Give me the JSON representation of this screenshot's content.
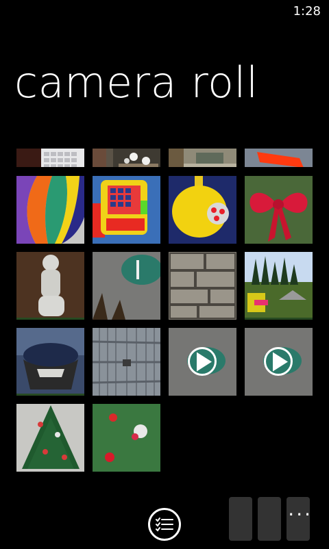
{
  "status": {
    "time": "1:28"
  },
  "page": {
    "title": "camera roll"
  },
  "appbar": {
    "select_icon": "checklist-icon",
    "more_label": "..."
  },
  "photos": [
    {
      "subject": "keyboard"
    },
    {
      "subject": "flower box"
    },
    {
      "subject": "patio"
    },
    {
      "subject": "traffic cone"
    },
    {
      "subject": "hot air balloon toy"
    },
    {
      "subject": "toy cash register"
    },
    {
      "subject": "yellow toy top"
    },
    {
      "subject": "red bow"
    },
    {
      "subject": "cherub statue"
    },
    {
      "subject": "football on gravel"
    },
    {
      "subject": "stone wall"
    },
    {
      "subject": "backyard"
    },
    {
      "subject": "bird bath"
    },
    {
      "subject": "wooden gate"
    },
    {
      "subject": "video 1",
      "type": "video"
    },
    {
      "subject": "video 2",
      "type": "video"
    },
    {
      "subject": "christmas tree"
    },
    {
      "subject": "tree ornaments"
    }
  ]
}
